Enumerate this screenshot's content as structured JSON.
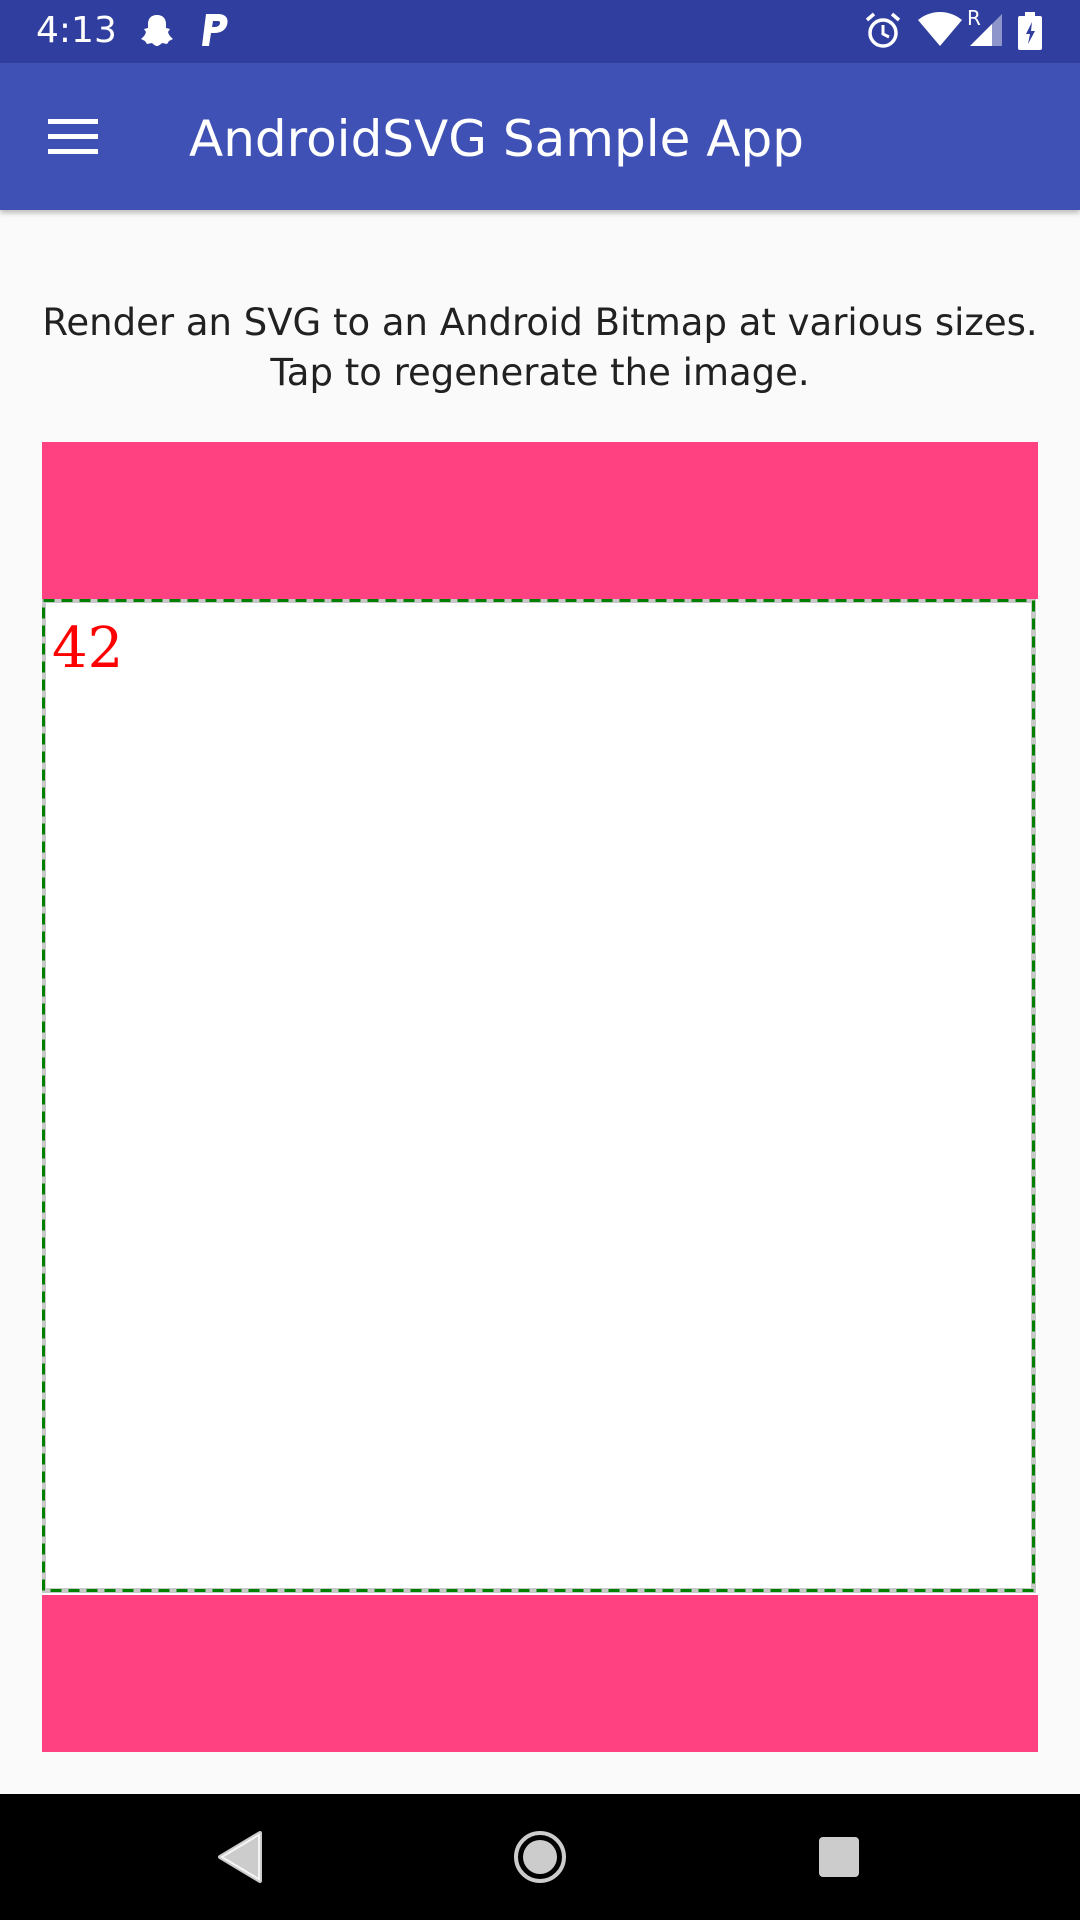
{
  "status_bar": {
    "time": "4:13",
    "left_icons": [
      "snapchat-icon",
      "paypal-icon"
    ],
    "right_icons": [
      "alarm-icon",
      "wifi-icon",
      "signal-icon",
      "battery-icon"
    ],
    "signal_label": "R"
  },
  "app_bar": {
    "menu_icon": "menu-icon",
    "title": "AndroidSVG Sample App"
  },
  "description": {
    "line1": "Render an SVG to an Android Bitmap at various sizes.",
    "line2": "Tap to regenerate the image."
  },
  "bitmap": {
    "number": "42",
    "padding_color": "#ff4081",
    "border_color": "#008000",
    "number_color": "#ff0000"
  },
  "nav_bar": {
    "buttons": [
      "back-icon",
      "home-icon",
      "recents-icon"
    ]
  },
  "colors": {
    "status_bar": "#303f9f",
    "app_bar": "#3f51b5",
    "background": "#fafafa"
  }
}
